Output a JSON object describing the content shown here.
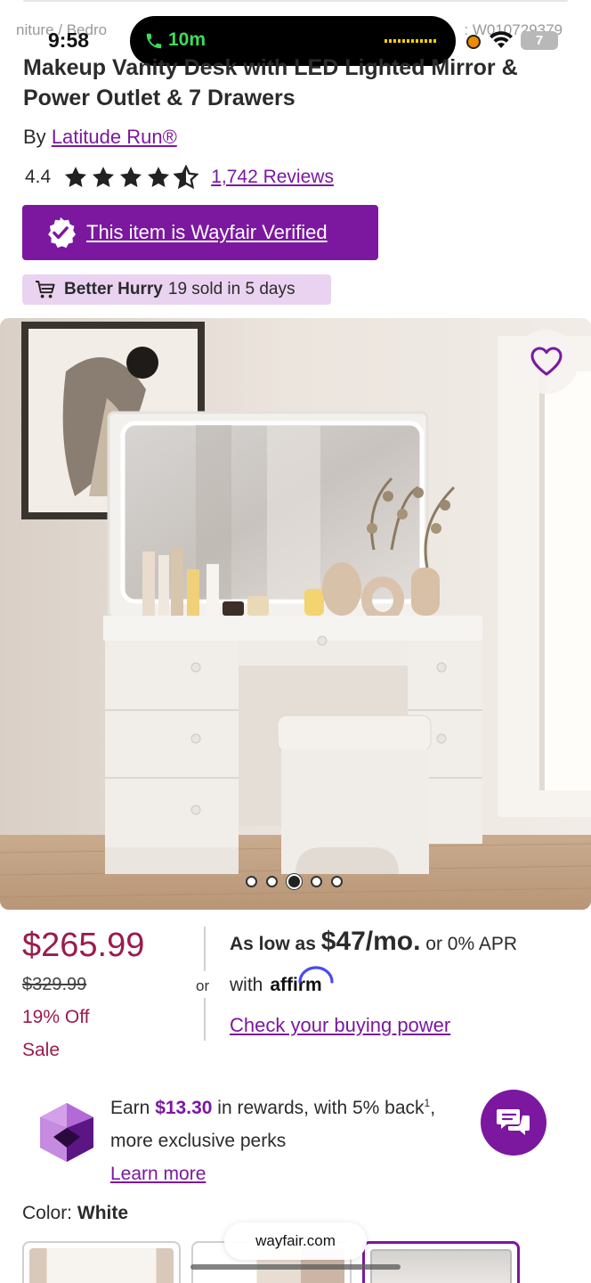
{
  "status_bar": {
    "time": "9:58",
    "call_duration": "10m",
    "battery": "7",
    "breadcrumb_left": "niture / Bedro",
    "breadcrumb_right": ": W010729379"
  },
  "product": {
    "title_line1": "Makeup Vanity Desk with LED Lighted Mirror &",
    "title_line2": "Power Outlet & 7 Drawers",
    "by_prefix": "By",
    "brand": "Latitude Run®",
    "rating": "4.4",
    "rating_value": 4.4,
    "rating_max": 5,
    "reviews": "1,742 Reviews",
    "verified_label": "This item is Wayfair Verified",
    "hurry_strong": "Better Hurry",
    "hurry_rest": "19 sold in 5 days"
  },
  "gallery": {
    "image_count": 5,
    "active_index": 2
  },
  "price": {
    "current": "$265.99",
    "was": "$329.99",
    "discount": "19% Off",
    "sale": "Sale",
    "or": "or",
    "as_low_prefix": "As low as",
    "monthly": "$47/mo.",
    "apr": "or 0% APR",
    "with": "with",
    "affirm": "affirm",
    "buying_power": "Check your buying power"
  },
  "rewards": {
    "earn_prefix": "Earn",
    "amount": "$13.30",
    "earn_suffix": "in rewards, with 5% back",
    "footnote": "1",
    "comma": ",",
    "perks": "more exclusive perks",
    "learn_more": "Learn more"
  },
  "color": {
    "label": "Color:",
    "value": "White"
  },
  "browser": {
    "url": "wayfair.com"
  },
  "colors": {
    "brand_purple": "#7b189f",
    "price_red": "#9b1b4b",
    "call_green": "#3ddc5b"
  }
}
